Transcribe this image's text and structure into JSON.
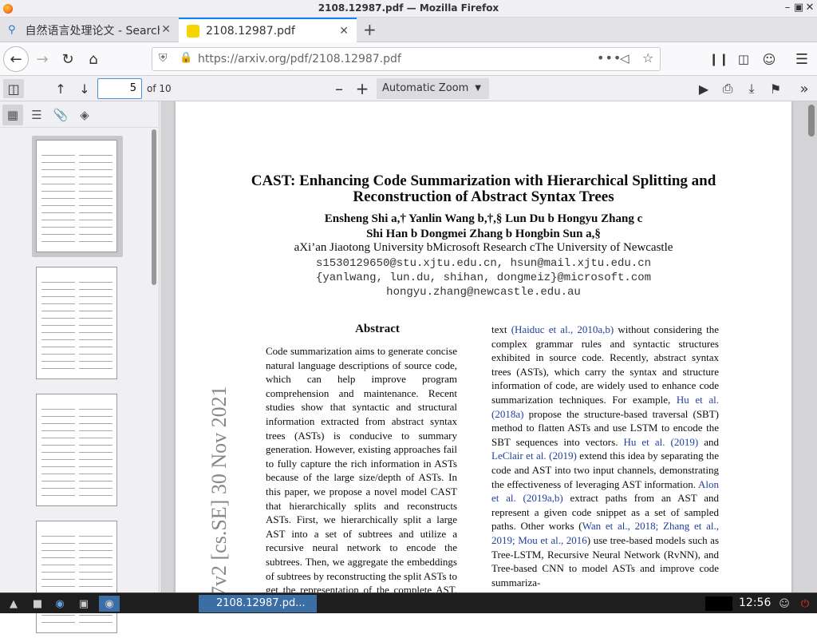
{
  "window": {
    "title": "2108.12987.pdf — Mozilla Firefox"
  },
  "tabs": [
    {
      "label": "自然语言处理论文 - Search"
    },
    {
      "label": "2108.12987.pdf"
    }
  ],
  "navbar": {
    "url": "https://arxiv.org/pdf/2108.12987.pdf"
  },
  "pdf_toolbar": {
    "page_current": "5",
    "page_of": "of 10",
    "zoom": "Automatic Zoom"
  },
  "paper": {
    "title_line1": "CAST: Enhancing Code Summarization with Hierarchical Splitting and",
    "title_line2": "Reconstruction of Abstract Syntax Trees",
    "authors_line1": "Ensheng Shi a,†  Yanlin Wang b,†,§  Lun Du b  Hongyu Zhang c",
    "authors_line2": "Shi Han b  Dongmei Zhang b  Hongbin Sun a,§",
    "affiliations": "aXi’an Jiaotong University   bMicrosoft Research   cThe University of Newcastle",
    "email1": "s1530129650@stu.xjtu.edu.cn, hsun@mail.xjtu.edu.cn",
    "email2": "{yanlwang, lun.du, shihan, dongmeiz}@microsoft.com",
    "email3": "hongyu.zhang@newcastle.edu.au",
    "abstract_heading": "Abstract",
    "abstract_text": "Code summarization aims to generate concise natural language descriptions of source code, which can help improve program comprehension and maintenance. Recent studies show that syntactic and structural information extracted from abstract syntax trees (ASTs) is conducive to summary generation. However, existing approaches fail to fully capture the rich information in ASTs because of the large size/depth of ASTs. In this paper, we propose a novel model CAST that hierarchically splits and reconstructs ASTs. First, we hierarchically split a large AST into a set of subtrees and utilize a recursive neural network to encode the subtrees. Then, we aggregate the embeddings of subtrees by reconstructing the split ASTs to get the representation of the complete AST. Finally, AST representation, together with source code embedding obtained by a vanilla code token en-",
    "col2_segments": [
      {
        "t": "text ",
        "c": false
      },
      {
        "t": "(Haiduc et al., 2010a,b)",
        "c": true
      },
      {
        "t": " without considering the complex grammar rules and syntactic structures exhibited in source code. Recently, abstract syntax trees (ASTs), which carry the syntax and structure information of code, are widely used to enhance code summarization techniques. For example, ",
        "c": false
      },
      {
        "t": "Hu et al. (2018a)",
        "c": true
      },
      {
        "t": " propose the structure-based traversal (SBT) method to flatten ASTs and use LSTM to encode the SBT sequences into vectors. ",
        "c": false
      },
      {
        "t": "Hu et al. (2019)",
        "c": true
      },
      {
        "t": " and ",
        "c": false
      },
      {
        "t": "LeClair et al. (2019)",
        "c": true
      },
      {
        "t": " extend this idea by separating the code and AST into two input channels, demonstrating the effectiveness of leveraging AST information. ",
        "c": false
      },
      {
        "t": "Alon et al. (2019a,b)",
        "c": true
      },
      {
        "t": " extract paths from an AST and represent a given code snippet as a set of sampled paths. Other works (",
        "c": false
      },
      {
        "t": "Wan et al., 2018; Zhang et al., 2019; Mou et al., 2016",
        "c": true
      },
      {
        "t": ") use tree-based models such as Tree-LSTM, Recursive Neural Network (RvNN), and Tree-based CNN to model ASTs and improve code summariza-",
        "c": false
      }
    ],
    "arxiv_stamp": "7v2  [cs.SE]  30 Nov 2021"
  },
  "taskbar": {
    "window_label": "2108.12987.pd...",
    "clock": "12:56"
  },
  "colors": {
    "accent": "#0a84ff",
    "cite": "#1f3fa0"
  }
}
